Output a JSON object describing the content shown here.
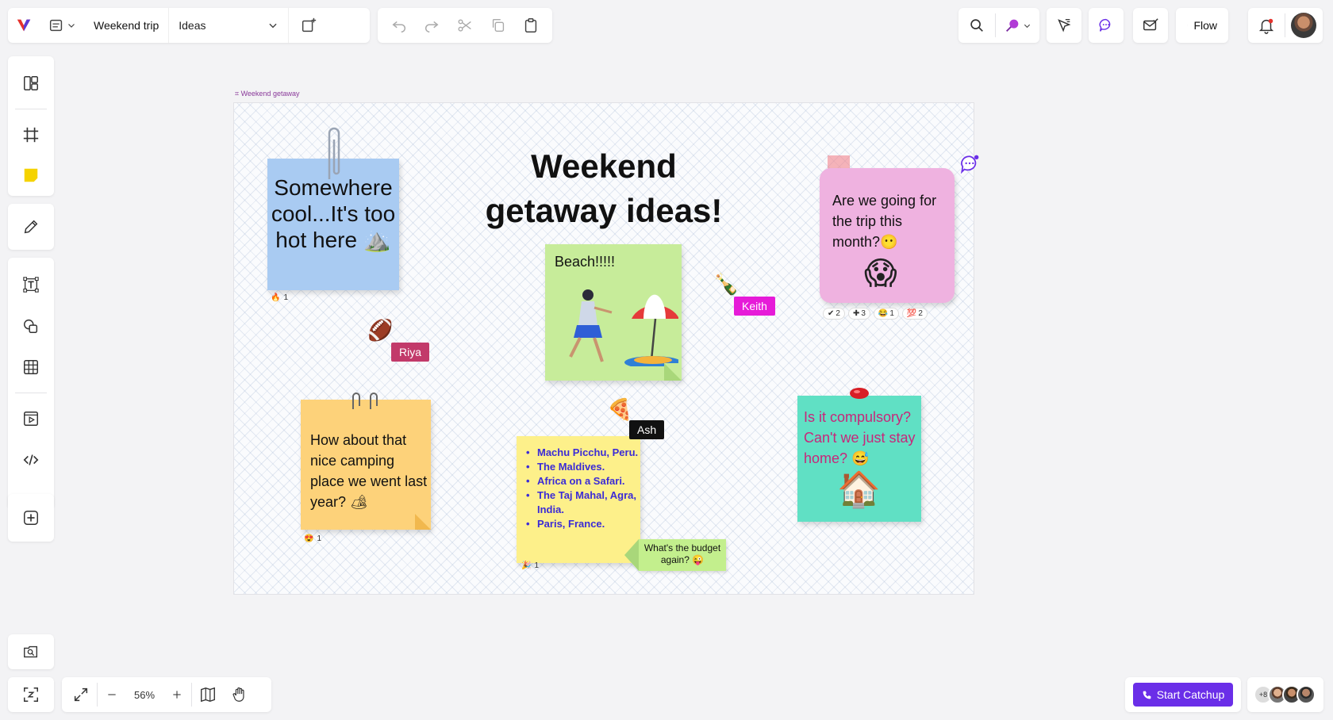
{
  "toolbar": {
    "board_name": "Weekend trip",
    "page_name": "Ideas",
    "flow_label": "Flow"
  },
  "board": {
    "label": "Weekend getaway",
    "title_line1": "Weekend",
    "title_line2": "getaway ideas!"
  },
  "notes": {
    "blue": "Somewhere cool...It's too hot here ⛰️",
    "green": "Beach!!!!!",
    "pink": "Are we going for the trip this month?😶",
    "yellow": "How about that nice camping place we went last year? 🏕",
    "teal": "Is it compulsory? Can't we just stay home? 😅",
    "list": [
      "Machu Picchu, Peru.",
      "The Maldives.",
      "Africa on a Safari.",
      "The Taj Mahal, Agra, India.",
      "Paris, France."
    ],
    "budget": "What's the budget again? 😜"
  },
  "cursors": {
    "riya": "Riya",
    "keith": "Keith",
    "ash": "Ash"
  },
  "reactions": {
    "blue": "1",
    "yellow": "1",
    "list": "1",
    "pink": [
      {
        "icon": "✔",
        "count": "2"
      },
      {
        "icon": "✚",
        "count": "3"
      },
      {
        "icon": "😂",
        "count": "1"
      },
      {
        "icon": "💯",
        "count": "2"
      }
    ]
  },
  "zoom": {
    "value": "56%"
  },
  "catchup": {
    "label": "Start Catchup"
  },
  "collaborators": {
    "extra_count": "+8"
  },
  "colors": {
    "accent": "#6a2ee8",
    "riya": "#c23a6a",
    "keith": "#e61bd8",
    "ash": "#111111"
  }
}
